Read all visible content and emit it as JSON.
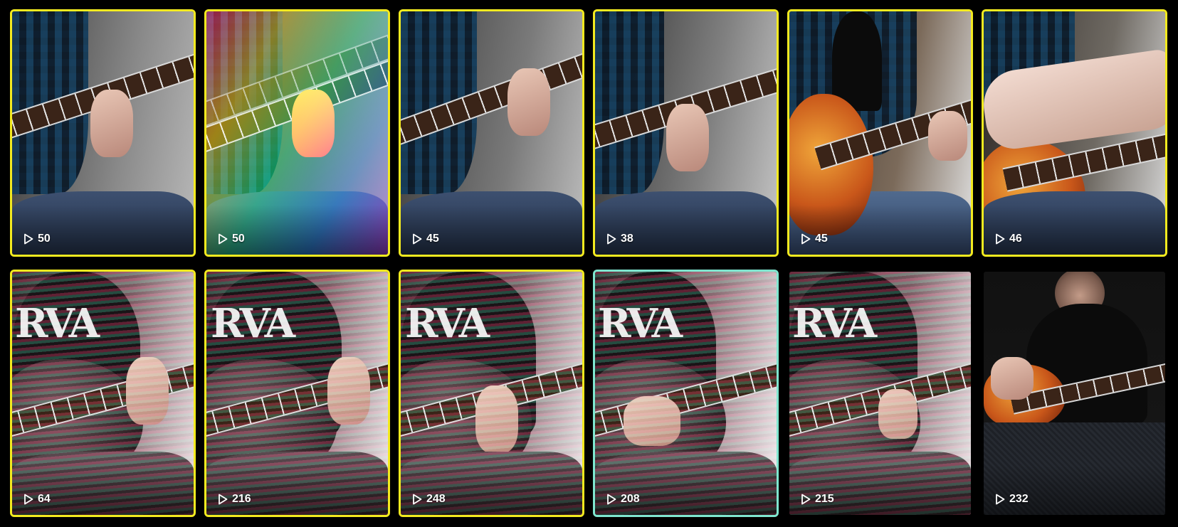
{
  "videos": [
    {
      "views": "50",
      "selection": "yellow",
      "scene": "plaid"
    },
    {
      "views": "50",
      "selection": "yellow",
      "scene": "rainbow"
    },
    {
      "views": "45",
      "selection": "yellow",
      "scene": "plaid"
    },
    {
      "views": "38",
      "selection": "yellow",
      "scene": "plaid"
    },
    {
      "views": "45",
      "selection": "yellow",
      "scene": "sunburst"
    },
    {
      "views": "46",
      "selection": "yellow",
      "scene": "arm"
    },
    {
      "views": "64",
      "selection": "yellow",
      "scene": "wavy"
    },
    {
      "views": "216",
      "selection": "yellow",
      "scene": "wavy"
    },
    {
      "views": "248",
      "selection": "yellow",
      "scene": "wavy"
    },
    {
      "views": "208",
      "selection": "teal",
      "scene": "wavy"
    },
    {
      "views": "215",
      "selection": "none",
      "scene": "wavy"
    },
    {
      "views": "232",
      "selection": "none",
      "scene": "dark"
    }
  ],
  "icons": {
    "views": "play-icon"
  },
  "colors": {
    "selected_yellow": "#f3ea1f",
    "selected_teal": "#7fe6cf",
    "background": "#000000"
  }
}
